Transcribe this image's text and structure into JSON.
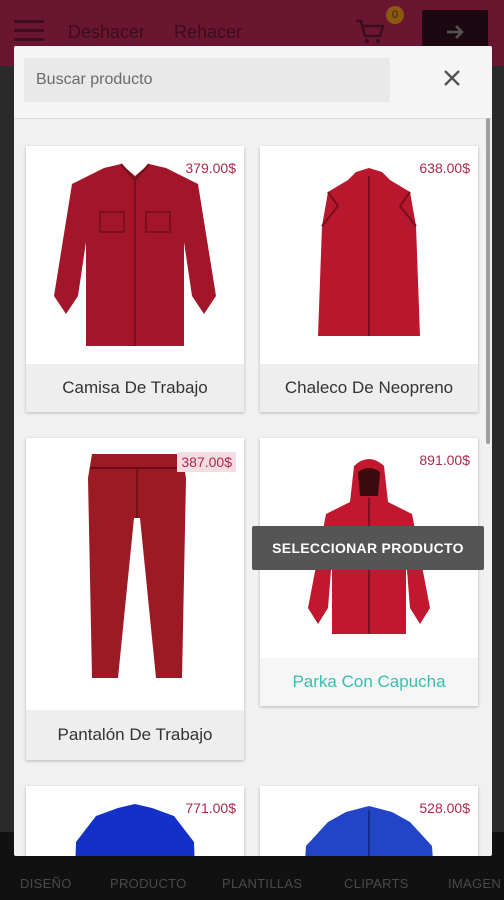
{
  "appbar": {
    "undo_label": "Deshacer",
    "redo_label": "Rehacer",
    "cart_count": "0",
    "next_icon": "arrow-right-icon"
  },
  "bottom_nav": {
    "items": [
      "DISEÑO",
      "PRODUCTO",
      "PLANTILLAS",
      "CLIPARTS",
      "IMAGEN"
    ]
  },
  "modal": {
    "search": {
      "placeholder": "Buscar producto",
      "value": ""
    },
    "close_icon": "close-icon",
    "tooltip": "SELECCIONAR PRODUCTO",
    "products": [
      {
        "name": "Camisa De Trabajo",
        "price": "379.00$",
        "color": "#a3162a"
      },
      {
        "name": "Chaleco De Neopreno",
        "price": "638.00$",
        "color": "#b8172e"
      },
      {
        "name": "Pantalón De Trabajo",
        "price": "387.00$",
        "color": "#9c1a24"
      },
      {
        "name": "Parka Con Capucha",
        "price": "891.00$",
        "color": "#c2182f",
        "selected": true
      },
      {
        "name": "",
        "price": "771.00$",
        "color": "#1330c8"
      },
      {
        "name": "",
        "price": "528.00$",
        "color": "#2245c8"
      }
    ]
  },
  "colors": {
    "appbar": "#6a1630",
    "price": "#b0284a",
    "selected_name": "#36bfae"
  }
}
